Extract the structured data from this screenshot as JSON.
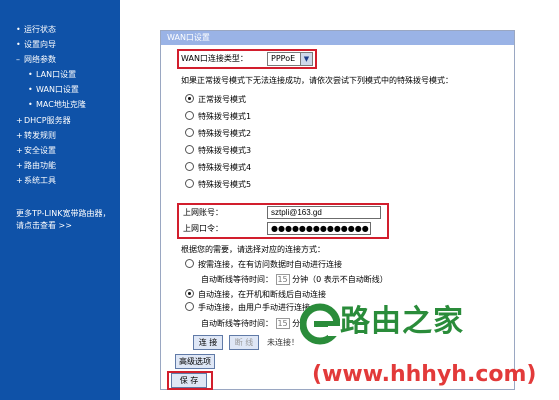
{
  "sidebar": {
    "items": [
      {
        "label": "运行状态",
        "bullet": "•"
      },
      {
        "label": "设置向导",
        "bullet": "•"
      },
      {
        "label": "网络参数",
        "bullet": "–"
      },
      {
        "label": "LAN口设置",
        "bullet": "•"
      },
      {
        "label": "WAN口设置",
        "bullet": "•"
      },
      {
        "label": "MAC地址克隆",
        "bullet": "•"
      },
      {
        "label": "DHCP服务器",
        "bullet": "+"
      },
      {
        "label": "转发规则",
        "bullet": "+"
      },
      {
        "label": "安全设置",
        "bullet": "+"
      },
      {
        "label": "路由功能",
        "bullet": "+"
      },
      {
        "label": "系统工具",
        "bullet": "+"
      }
    ],
    "more_note": "更多TP-LINK宽带路由器，请点击查看 >>"
  },
  "panel": {
    "title": "WAN口设置",
    "wan_type_label": "WAN口连接类型：",
    "wan_type_value": "PPPoE",
    "dial_hint": "如果正常拨号模式下无法连接成功，请依次尝试下列模式中的特殊拨号模式：",
    "dial_modes": [
      {
        "label": "正常拨号模式",
        "checked": true
      },
      {
        "label": "特殊拨号模式1",
        "checked": false
      },
      {
        "label": "特殊拨号模式2",
        "checked": false
      },
      {
        "label": "特殊拨号模式3",
        "checked": false
      },
      {
        "label": "特殊拨号模式4",
        "checked": false
      },
      {
        "label": "特殊拨号模式5",
        "checked": false
      }
    ],
    "account_label": "上网账号：",
    "account_value": "sztpli@163.gd",
    "password_label": "上网口令：",
    "password_value": "●●●●●●●●●●●●●●",
    "conn_hint": "根据您的需要，请选择对应的连接方式：",
    "on_demand_label": "按需连接，在有访问数据时自动进行连接",
    "auto_disconnect_label_1": "自动断线等待时间：",
    "auto_disconnect_value_1": "15",
    "auto_disconnect_suffix_1": "分钟（0 表示不自动断线）",
    "auto_connect_label": "自动连接，在开机和断线后自动连接",
    "manual_label": "手动连接，由用户手动进行连接",
    "auto_disconnect_label_2": "自动断线等待时间：",
    "auto_disconnect_value_2": "15",
    "auto_disconnect_suffix_2": "分",
    "connect_button": "连 接",
    "disconnect_button": "断 线",
    "status_text": "未连接！",
    "advanced_button": "高级选项",
    "save_button": "保 存"
  },
  "watermark": {
    "brand": "路由之家",
    "url": "(www.hhhyh.com)"
  },
  "colors": {
    "sidebar_bg": "#0f52a8",
    "panel_header_bg": "#9ab3e6",
    "highlight_red": "#d21e2d",
    "watermark_green": "#2a8c3a",
    "watermark_red": "#e23a3a"
  }
}
